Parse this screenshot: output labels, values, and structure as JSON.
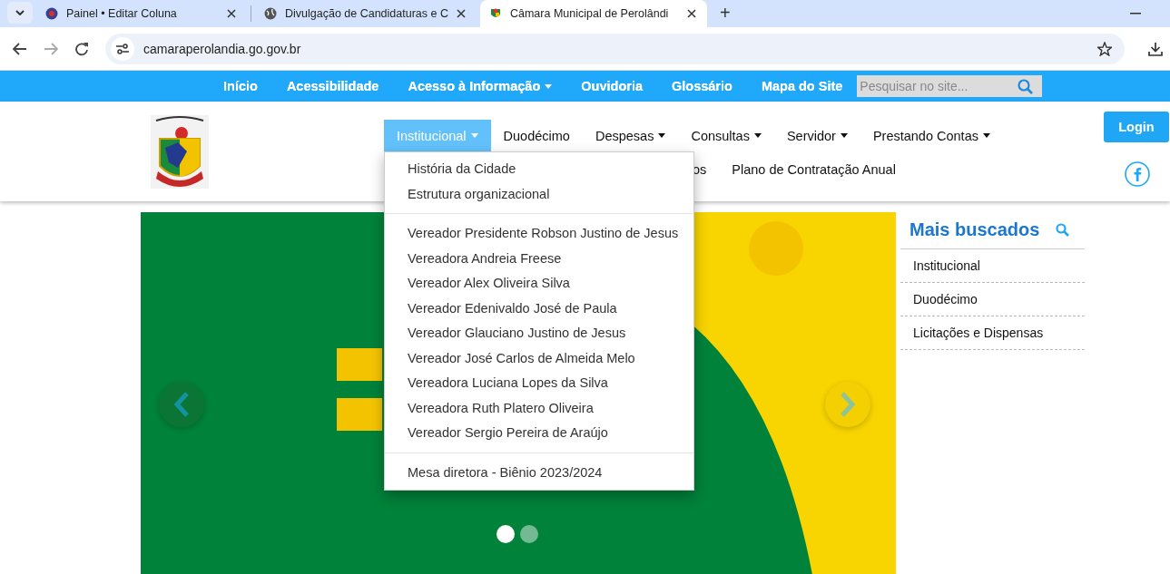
{
  "browser": {
    "tabs": [
      {
        "title": "Painel • Editar Coluna",
        "selected": false
      },
      {
        "title": "Divulgação de Candidaturas e C",
        "selected": false
      },
      {
        "title": "Câmara Municipal de Perolândi",
        "selected": true
      }
    ],
    "new_tab": "+",
    "url": "camaraperolandia.go.gov.br"
  },
  "top_bar": {
    "links": [
      {
        "label": "Início",
        "dropdown": false
      },
      {
        "label": "Acessibilidade",
        "dropdown": false
      },
      {
        "label": "Acesso à Informação",
        "dropdown": true
      },
      {
        "label": "Ouvidoria",
        "dropdown": false
      },
      {
        "label": "Glossário",
        "dropdown": false
      },
      {
        "label": "Mapa do Site",
        "dropdown": false
      }
    ],
    "search": {
      "placeholder": "Pesquisar no site..."
    }
  },
  "main_nav": {
    "items": [
      {
        "label": "Institucional",
        "dropdown": true,
        "selected": true
      },
      {
        "label": "Duodécimo",
        "dropdown": false,
        "selected": false
      },
      {
        "label": "Despesas",
        "dropdown": true,
        "selected": false
      },
      {
        "label": "Consultas",
        "dropdown": true,
        "selected": false
      },
      {
        "label": "Servidor",
        "dropdown": true,
        "selected": false
      },
      {
        "label": "Prestando Contas",
        "dropdown": true,
        "selected": false
      }
    ],
    "row_2": [
      "os",
      "Plano de Contratação Anual"
    ]
  },
  "login": "Login",
  "dropdown": {
    "groups": [
      [
        "História da Cidade",
        "Estrutura organizacional"
      ],
      [
        "Vereador Presidente Robson Justino de Jesus",
        "Vereadora Andreia Freese",
        "Vereador Alex Oliveira Silva",
        "Vereador Edenivaldo José de Paula",
        "Vereador Glauciano Justino de Jesus",
        "Vereador José Carlos de Almeida Melo",
        "Vereadora Luciana Lopes da Silva",
        "Vereadora Ruth Platero Oliveira",
        "Vereador Sergio Pereira de Araújo"
      ],
      [
        "Mesa diretora - Biênio 2023/2024"
      ]
    ]
  },
  "slider": {
    "dots": [
      {
        "selected": true
      },
      {
        "selected": false
      }
    ]
  },
  "sidebar": {
    "title": "Mais buscados",
    "items": [
      "Institucional",
      "Duodécimo",
      "Licitações e Dispensas"
    ]
  }
}
